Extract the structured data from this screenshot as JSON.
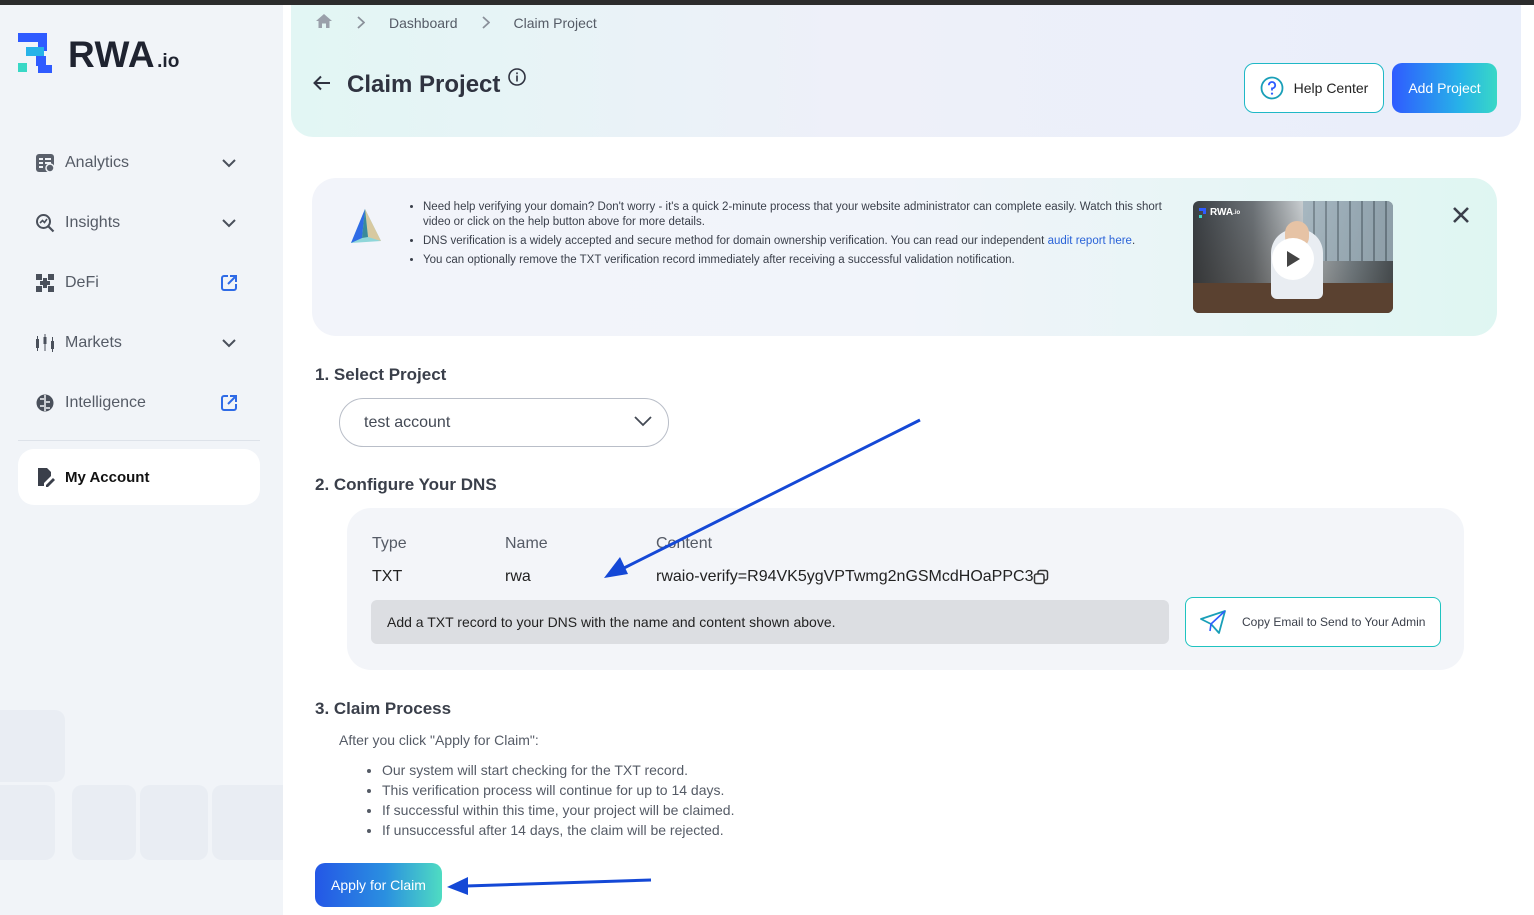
{
  "brand": {
    "name": "RWA",
    "suffix": ".io",
    "accent": "#2f5bff",
    "teal": "#1fb8c6"
  },
  "sidebar": {
    "items": [
      {
        "label": "Analytics",
        "icon": "analytics-icon",
        "right": "chevron-down-icon"
      },
      {
        "label": "Insights",
        "icon": "search-chart-icon",
        "right": "chevron-down-icon"
      },
      {
        "label": "DeFi",
        "icon": "defi-grid-icon",
        "right": "external-link-icon"
      },
      {
        "label": "Markets",
        "icon": "candlestick-icon",
        "right": "chevron-down-icon"
      },
      {
        "label": "Intelligence",
        "icon": "brain-icon",
        "right": "external-link-icon"
      }
    ],
    "account": {
      "label": "My Account",
      "icon": "account-edit-icon"
    }
  },
  "header": {
    "breadcrumb": [
      "Dashboard",
      "Claim Project"
    ],
    "title": "Claim Project",
    "help_label": "Help Center",
    "add_label": "Add Project"
  },
  "info": {
    "bullets": [
      "Need help verifying your domain? Don't worry - it's a quick 2-minute process that your website administrator can complete easily. Watch this short video or click on the help button above for more details.",
      "DNS verification is a widely accepted and secure method for domain ownership verification. You can read our independent ",
      "You can optionally remove the TXT verification record immediately after receiving a successful validation notification."
    ],
    "link_text": "audit report here",
    "link_suffix": ".",
    "video_logo": "RWA",
    "video_logo_suffix": ".io"
  },
  "step1": {
    "heading": "1. Select Project",
    "selected": "test account"
  },
  "step2": {
    "heading": "2. Configure Your DNS",
    "headers": {
      "type": "Type",
      "name": "Name",
      "content": "Content"
    },
    "record": {
      "type": "TXT",
      "name": "rwa",
      "content": "rwaio-verify=R94VK5ygVPTwmg2nGSMcdHOaPPC3"
    },
    "note": "Add a TXT record to your DNS with the name and content shown above.",
    "email_button": "Copy Email to Send to Your Admin"
  },
  "step3": {
    "heading": "3. Claim Process",
    "intro": "After you click \"Apply for Claim\":",
    "bullets": [
      "Our system will start checking for the TXT record.",
      "This verification process will continue for up to 14 days.",
      "If successful within this time, your project will be claimed.",
      "If unsuccessful after 14 days, the claim will be rejected."
    ],
    "apply_label": "Apply for Claim"
  }
}
